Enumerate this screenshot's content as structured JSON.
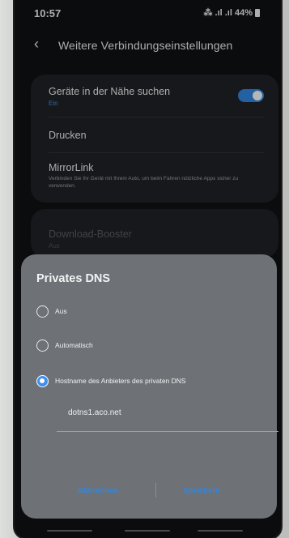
{
  "status": {
    "time": "10:57",
    "right": "⁂ .ıl .ıl 44%"
  },
  "header": {
    "title": "Weitere Verbindungseinstellungen"
  },
  "settings": {
    "nearby": {
      "title": "Geräte in der Nähe suchen",
      "sub": "Ein",
      "toggle_on": true
    },
    "print": {
      "title": "Drucken"
    },
    "mirrorlink": {
      "title": "MirrorLink",
      "desc": "Verbinden Sie Ihr Gerät mit Ihrem Auto, um beim Fahren nützliche Apps sicher zu verwenden."
    },
    "download_booster": {
      "title": "Download-Booster",
      "sub": "Aus"
    }
  },
  "dialog": {
    "title": "Privates DNS",
    "options": [
      {
        "label": "Aus",
        "selected": false
      },
      {
        "label": "Automatisch",
        "selected": false
      },
      {
        "label": "Hostname des Anbieters des privaten DNS",
        "selected": true
      }
    ],
    "hostname_value": "dotns1.aco.net",
    "cancel_label": "Abbrechen",
    "save_label": "Speichern"
  },
  "colors": {
    "accent": "#2f82d9",
    "dialog_bg": "#6e7277",
    "screen_bg": "#0f1113"
  }
}
